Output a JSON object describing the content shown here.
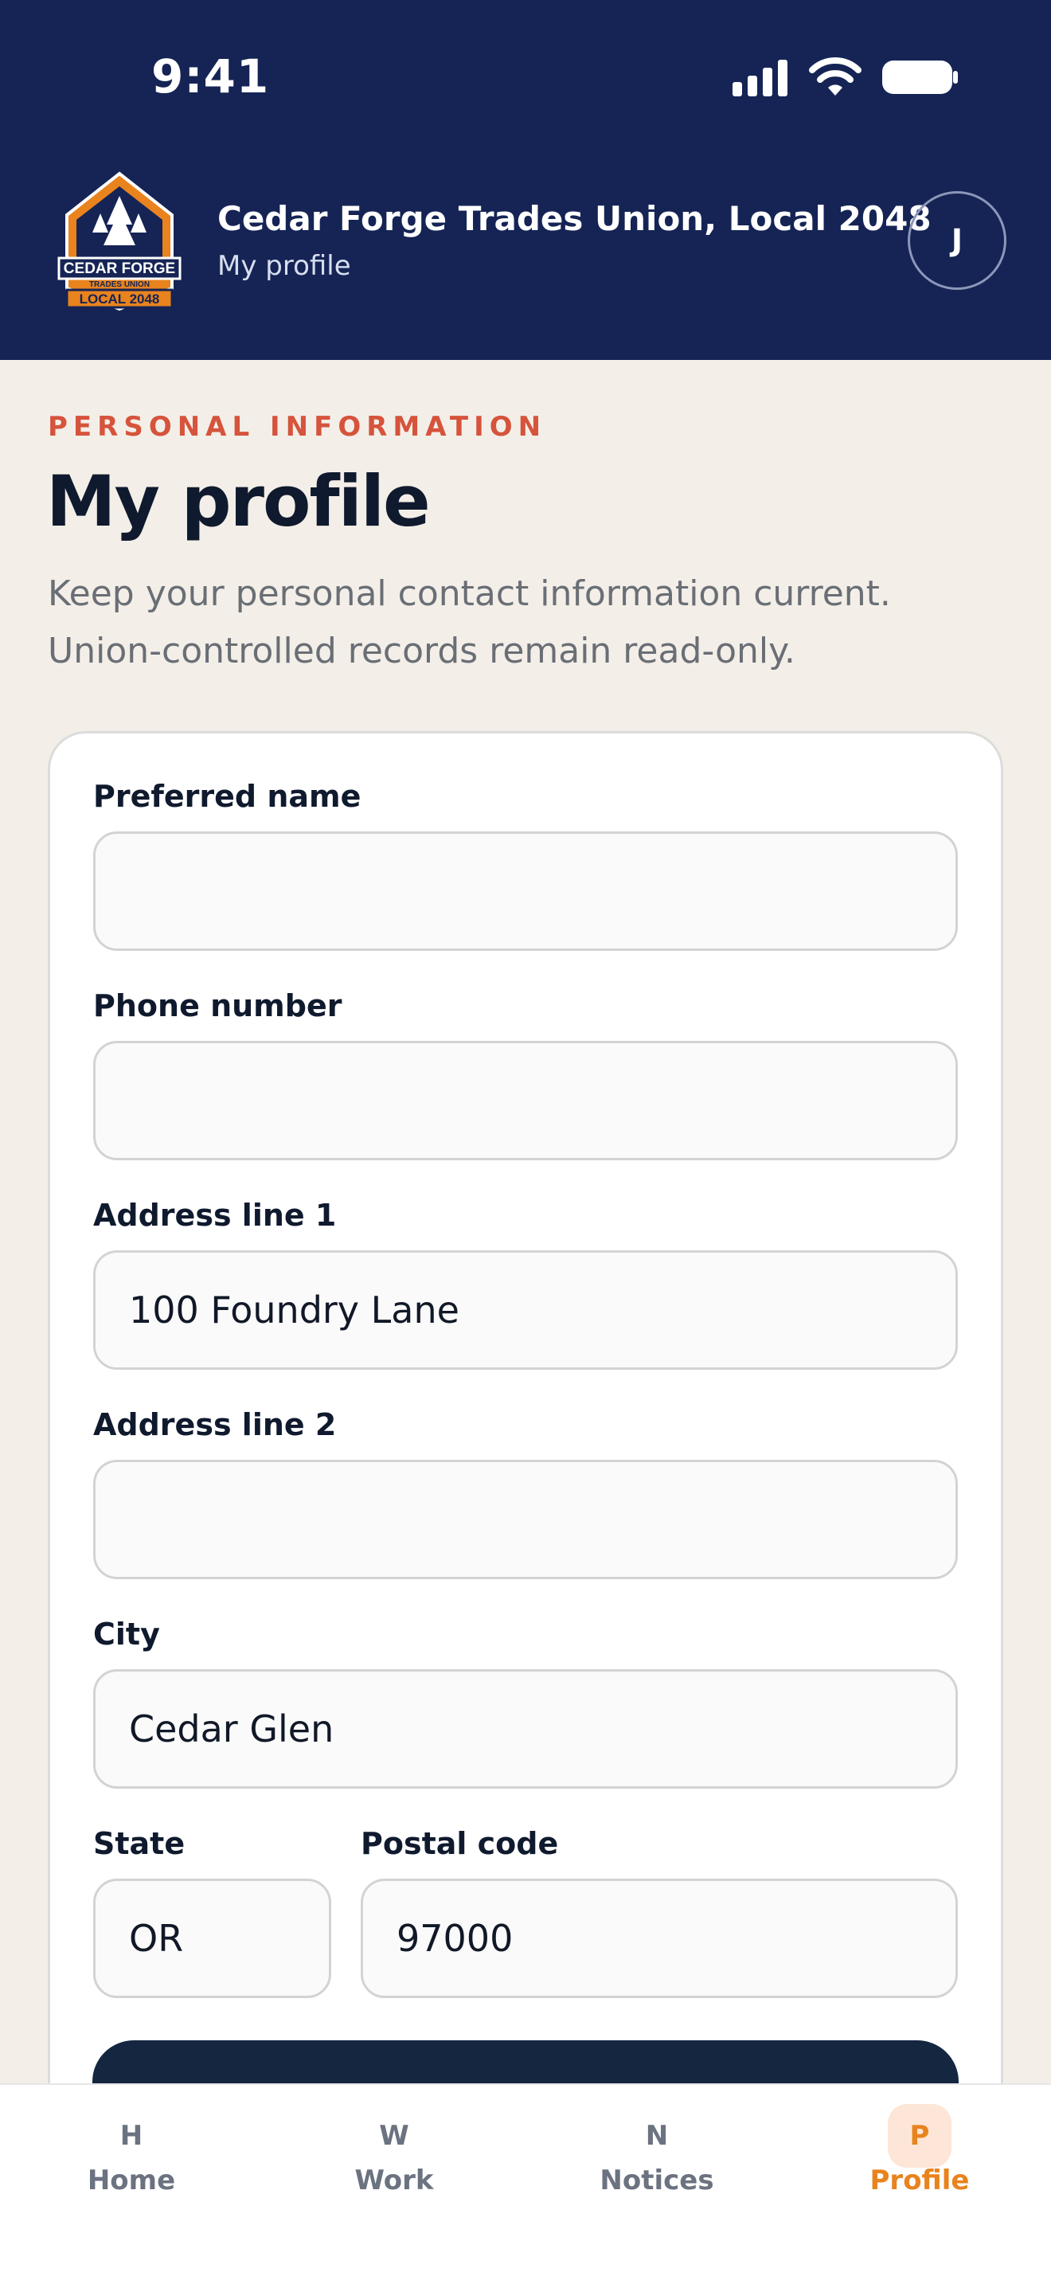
{
  "status_bar": {
    "time": "9:41"
  },
  "header": {
    "union_name": "Cedar Forge Trades Union, Local 2048",
    "subtitle": "My profile",
    "avatar_initial": "J",
    "logo": {
      "line1": "CEDAR FORGE",
      "line2": "TRADES UNION",
      "line3": "LOCAL 2048"
    }
  },
  "intro": {
    "eyebrow": "PERSONAL INFORMATION",
    "title": "My profile",
    "description": "Keep your personal contact information current. Union-controlled records remain read-only."
  },
  "form": {
    "fields": {
      "preferred_name": {
        "label": "Preferred name",
        "value": ""
      },
      "phone_number": {
        "label": "Phone number",
        "value": ""
      },
      "address_line_1": {
        "label": "Address line 1",
        "value": "100 Foundry Lane"
      },
      "address_line_2": {
        "label": "Address line 2",
        "value": ""
      },
      "city": {
        "label": "City",
        "value": "Cedar Glen"
      },
      "state": {
        "label": "State",
        "value": "OR"
      },
      "postal_code": {
        "label": "Postal code",
        "value": "97000"
      }
    }
  },
  "nav": {
    "items": [
      {
        "key": "H",
        "label": "Home"
      },
      {
        "key": "W",
        "label": "Work"
      },
      {
        "key": "N",
        "label": "Notices"
      },
      {
        "key": "P",
        "label": "Profile"
      }
    ],
    "active": "Profile"
  },
  "colors": {
    "header_bg": "#152455",
    "page_bg": "#f3efe8",
    "eyebrow": "#d6533c",
    "accent": "#e8831e",
    "primary_button": "#142640"
  }
}
